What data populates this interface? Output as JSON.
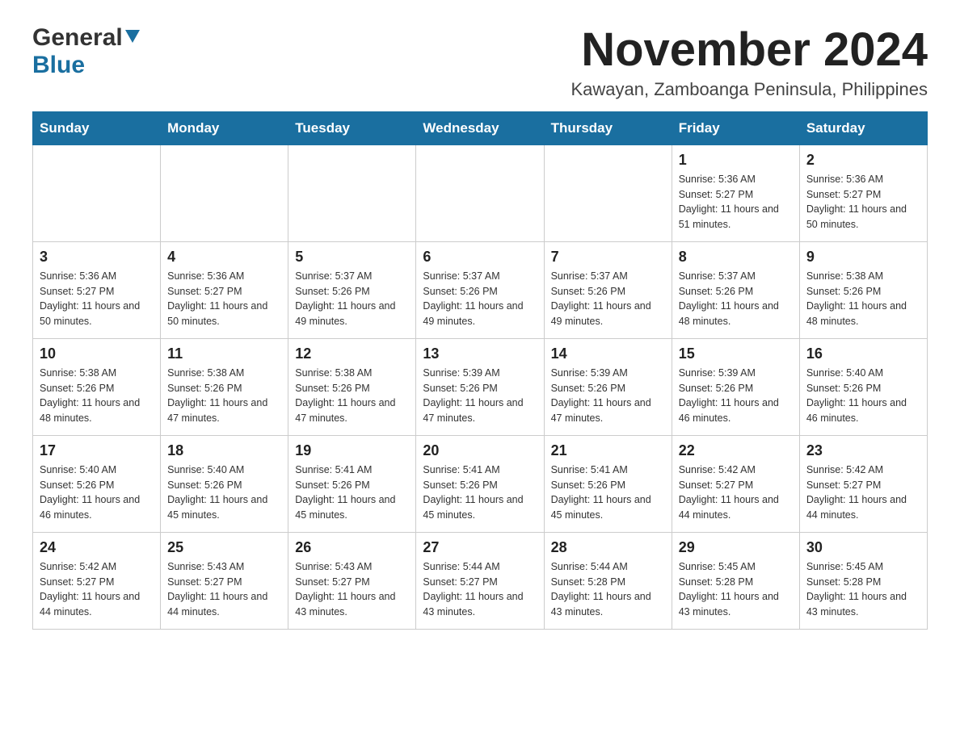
{
  "logo": {
    "general": "General",
    "blue": "Blue",
    "triangle": "▼"
  },
  "title": "November 2024",
  "subtitle": "Kawayan, Zamboanga Peninsula, Philippines",
  "days_of_week": [
    "Sunday",
    "Monday",
    "Tuesday",
    "Wednesday",
    "Thursday",
    "Friday",
    "Saturday"
  ],
  "weeks": [
    [
      {
        "day": "",
        "sunrise": "",
        "sunset": "",
        "daylight": ""
      },
      {
        "day": "",
        "sunrise": "",
        "sunset": "",
        "daylight": ""
      },
      {
        "day": "",
        "sunrise": "",
        "sunset": "",
        "daylight": ""
      },
      {
        "day": "",
        "sunrise": "",
        "sunset": "",
        "daylight": ""
      },
      {
        "day": "",
        "sunrise": "",
        "sunset": "",
        "daylight": ""
      },
      {
        "day": "1",
        "sunrise": "Sunrise: 5:36 AM",
        "sunset": "Sunset: 5:27 PM",
        "daylight": "Daylight: 11 hours and 51 minutes."
      },
      {
        "day": "2",
        "sunrise": "Sunrise: 5:36 AM",
        "sunset": "Sunset: 5:27 PM",
        "daylight": "Daylight: 11 hours and 50 minutes."
      }
    ],
    [
      {
        "day": "3",
        "sunrise": "Sunrise: 5:36 AM",
        "sunset": "Sunset: 5:27 PM",
        "daylight": "Daylight: 11 hours and 50 minutes."
      },
      {
        "day": "4",
        "sunrise": "Sunrise: 5:36 AM",
        "sunset": "Sunset: 5:27 PM",
        "daylight": "Daylight: 11 hours and 50 minutes."
      },
      {
        "day": "5",
        "sunrise": "Sunrise: 5:37 AM",
        "sunset": "Sunset: 5:26 PM",
        "daylight": "Daylight: 11 hours and 49 minutes."
      },
      {
        "day": "6",
        "sunrise": "Sunrise: 5:37 AM",
        "sunset": "Sunset: 5:26 PM",
        "daylight": "Daylight: 11 hours and 49 minutes."
      },
      {
        "day": "7",
        "sunrise": "Sunrise: 5:37 AM",
        "sunset": "Sunset: 5:26 PM",
        "daylight": "Daylight: 11 hours and 49 minutes."
      },
      {
        "day": "8",
        "sunrise": "Sunrise: 5:37 AM",
        "sunset": "Sunset: 5:26 PM",
        "daylight": "Daylight: 11 hours and 48 minutes."
      },
      {
        "day": "9",
        "sunrise": "Sunrise: 5:38 AM",
        "sunset": "Sunset: 5:26 PM",
        "daylight": "Daylight: 11 hours and 48 minutes."
      }
    ],
    [
      {
        "day": "10",
        "sunrise": "Sunrise: 5:38 AM",
        "sunset": "Sunset: 5:26 PM",
        "daylight": "Daylight: 11 hours and 48 minutes."
      },
      {
        "day": "11",
        "sunrise": "Sunrise: 5:38 AM",
        "sunset": "Sunset: 5:26 PM",
        "daylight": "Daylight: 11 hours and 47 minutes."
      },
      {
        "day": "12",
        "sunrise": "Sunrise: 5:38 AM",
        "sunset": "Sunset: 5:26 PM",
        "daylight": "Daylight: 11 hours and 47 minutes."
      },
      {
        "day": "13",
        "sunrise": "Sunrise: 5:39 AM",
        "sunset": "Sunset: 5:26 PM",
        "daylight": "Daylight: 11 hours and 47 minutes."
      },
      {
        "day": "14",
        "sunrise": "Sunrise: 5:39 AM",
        "sunset": "Sunset: 5:26 PM",
        "daylight": "Daylight: 11 hours and 47 minutes."
      },
      {
        "day": "15",
        "sunrise": "Sunrise: 5:39 AM",
        "sunset": "Sunset: 5:26 PM",
        "daylight": "Daylight: 11 hours and 46 minutes."
      },
      {
        "day": "16",
        "sunrise": "Sunrise: 5:40 AM",
        "sunset": "Sunset: 5:26 PM",
        "daylight": "Daylight: 11 hours and 46 minutes."
      }
    ],
    [
      {
        "day": "17",
        "sunrise": "Sunrise: 5:40 AM",
        "sunset": "Sunset: 5:26 PM",
        "daylight": "Daylight: 11 hours and 46 minutes."
      },
      {
        "day": "18",
        "sunrise": "Sunrise: 5:40 AM",
        "sunset": "Sunset: 5:26 PM",
        "daylight": "Daylight: 11 hours and 45 minutes."
      },
      {
        "day": "19",
        "sunrise": "Sunrise: 5:41 AM",
        "sunset": "Sunset: 5:26 PM",
        "daylight": "Daylight: 11 hours and 45 minutes."
      },
      {
        "day": "20",
        "sunrise": "Sunrise: 5:41 AM",
        "sunset": "Sunset: 5:26 PM",
        "daylight": "Daylight: 11 hours and 45 minutes."
      },
      {
        "day": "21",
        "sunrise": "Sunrise: 5:41 AM",
        "sunset": "Sunset: 5:26 PM",
        "daylight": "Daylight: 11 hours and 45 minutes."
      },
      {
        "day": "22",
        "sunrise": "Sunrise: 5:42 AM",
        "sunset": "Sunset: 5:27 PM",
        "daylight": "Daylight: 11 hours and 44 minutes."
      },
      {
        "day": "23",
        "sunrise": "Sunrise: 5:42 AM",
        "sunset": "Sunset: 5:27 PM",
        "daylight": "Daylight: 11 hours and 44 minutes."
      }
    ],
    [
      {
        "day": "24",
        "sunrise": "Sunrise: 5:42 AM",
        "sunset": "Sunset: 5:27 PM",
        "daylight": "Daylight: 11 hours and 44 minutes."
      },
      {
        "day": "25",
        "sunrise": "Sunrise: 5:43 AM",
        "sunset": "Sunset: 5:27 PM",
        "daylight": "Daylight: 11 hours and 44 minutes."
      },
      {
        "day": "26",
        "sunrise": "Sunrise: 5:43 AM",
        "sunset": "Sunset: 5:27 PM",
        "daylight": "Daylight: 11 hours and 43 minutes."
      },
      {
        "day": "27",
        "sunrise": "Sunrise: 5:44 AM",
        "sunset": "Sunset: 5:27 PM",
        "daylight": "Daylight: 11 hours and 43 minutes."
      },
      {
        "day": "28",
        "sunrise": "Sunrise: 5:44 AM",
        "sunset": "Sunset: 5:28 PM",
        "daylight": "Daylight: 11 hours and 43 minutes."
      },
      {
        "day": "29",
        "sunrise": "Sunrise: 5:45 AM",
        "sunset": "Sunset: 5:28 PM",
        "daylight": "Daylight: 11 hours and 43 minutes."
      },
      {
        "day": "30",
        "sunrise": "Sunrise: 5:45 AM",
        "sunset": "Sunset: 5:28 PM",
        "daylight": "Daylight: 11 hours and 43 minutes."
      }
    ]
  ]
}
